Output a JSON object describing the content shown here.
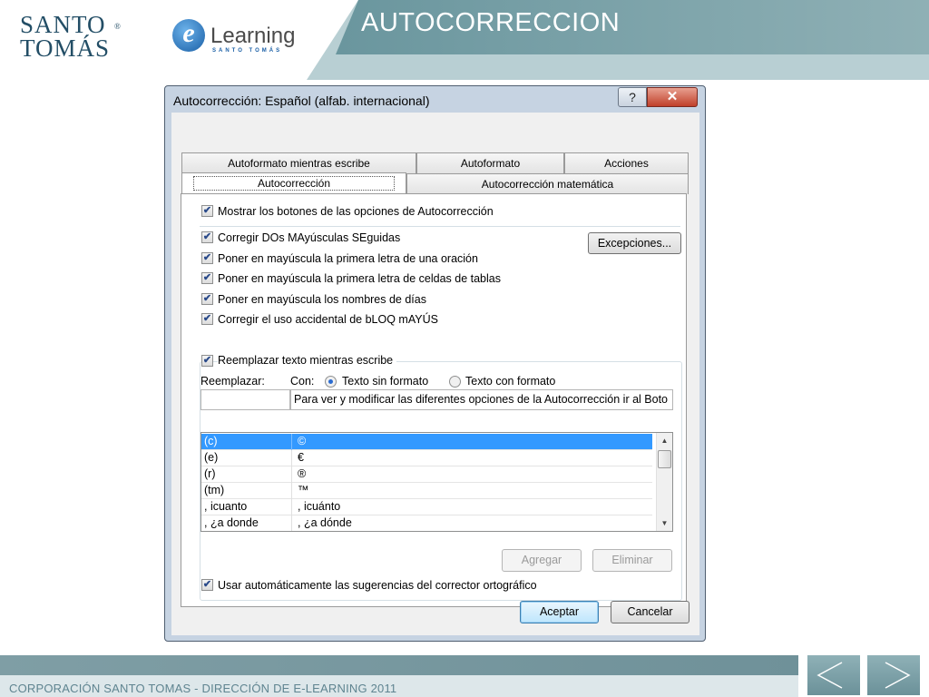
{
  "header": {
    "logo_santo_tomas": {
      "line1": "SANTO",
      "line2": "TOMÁS",
      "reg": "®"
    },
    "logo_elearning": {
      "e": "e",
      "word": "Learning",
      "sub": "SANTO TOMÁS"
    },
    "title": "AUTOCORRECCION",
    "colors": {
      "banner": "#6f9ba3",
      "banner_light": "#b8cfd3"
    }
  },
  "dialog": {
    "title": "Autocorrección: Español (alfab. internacional)",
    "help_label": "?",
    "close_label": "✕",
    "tabs_row1": [
      "Autoformato mientras escribe",
      "Autoformato",
      "Acciones"
    ],
    "tabs_row2": [
      "Autocorrección",
      "Autocorrección matemática"
    ],
    "active_tab": "Autocorrección",
    "show_options_buttons": {
      "label": "Mostrar los botones de las opciones de Autocorrección",
      "checked": true
    },
    "options": [
      {
        "label": "Corregir DOs MAyúsculas SEguidas",
        "checked": true
      },
      {
        "label": "Poner en mayúscula la primera letra de una oración",
        "checked": true
      },
      {
        "label": "Poner en mayúscula la primera letra de celdas de tablas",
        "checked": true
      },
      {
        "label": "Poner en mayúscula los nombres de días",
        "checked": true
      },
      {
        "label": "Corregir el uso accidental de bLOQ mAYÚS",
        "checked": true
      }
    ],
    "exceptions_button": "Excepciones...",
    "replace_group": {
      "checkbox_label": "Reemplazar texto mientras escribe",
      "checked": true,
      "replace_label": "Reemplazar:",
      "with_label": "Con:",
      "radio_plain": {
        "label": "Texto sin formato",
        "selected": true
      },
      "radio_formatted": {
        "label": "Texto con formato",
        "selected": false
      },
      "replace_value": "",
      "with_value": "Para ver y modificar las diferentes opciones de la Autocorrección ir al Boto",
      "entries": [
        {
          "replace": "(c)",
          "with": "©",
          "selected": true
        },
        {
          "replace": "(e)",
          "with": "€",
          "selected": false
        },
        {
          "replace": "(r)",
          "with": "®",
          "selected": false
        },
        {
          "replace": "(tm)",
          "with": "™",
          "selected": false
        },
        {
          "replace": ", icuanto",
          "with": ", icuánto",
          "selected": false
        },
        {
          "replace": ", ¿a donde",
          "with": ", ¿a dónde",
          "selected": false
        }
      ],
      "add_button": "Agregar",
      "delete_button": "Eliminar",
      "auto_suggestions": {
        "label": "Usar automáticamente las sugerencias del corrector ortográfico",
        "checked": true
      }
    },
    "ok_button": "Aceptar",
    "cancel_button": "Cancelar"
  },
  "footer": {
    "text": "CORPORACIÓN SANTO TOMAS - DIRECCIÓN DE E-LEARNING  2011",
    "prev_label": "previous",
    "next_label": "next"
  }
}
